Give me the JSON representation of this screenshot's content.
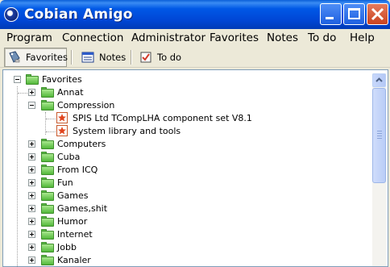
{
  "window": {
    "title": "Cobian Amigo",
    "controls": [
      "minimize",
      "maximize",
      "close"
    ]
  },
  "menu": {
    "items": [
      "Program",
      "Connection",
      "Administrator",
      "Favorites",
      "Notes",
      "To do",
      "Help"
    ]
  },
  "toolbar": {
    "favorites_label": "Favorites",
    "notes_label": "Notes",
    "todo_label": "To do",
    "active": "Favorites"
  },
  "tree": {
    "root": {
      "label": "Favorites",
      "expanded": true
    },
    "items": [
      {
        "label": "Annat",
        "type": "folder",
        "level": 1,
        "expanded": false
      },
      {
        "label": "Compression",
        "type": "folder",
        "level": 1,
        "expanded": true
      },
      {
        "label": "SPIS Ltd TCompLHA component set V8.1",
        "type": "favorite",
        "level": 2
      },
      {
        "label": "System library and tools",
        "type": "favorite",
        "level": 2
      },
      {
        "label": "Computers",
        "type": "folder",
        "level": 1,
        "expanded": false
      },
      {
        "label": "Cuba",
        "type": "folder",
        "level": 1,
        "expanded": false
      },
      {
        "label": "From ICQ",
        "type": "folder",
        "level": 1,
        "expanded": false
      },
      {
        "label": "Fun",
        "type": "folder",
        "level": 1,
        "expanded": false
      },
      {
        "label": "Games",
        "type": "folder",
        "level": 1,
        "expanded": false
      },
      {
        "label": "Games,shit",
        "type": "folder",
        "level": 1,
        "expanded": false
      },
      {
        "label": "Humor",
        "type": "folder",
        "level": 1,
        "expanded": false
      },
      {
        "label": "Internet",
        "type": "folder",
        "level": 1,
        "expanded": false
      },
      {
        "label": "Jobb",
        "type": "folder",
        "level": 1,
        "expanded": false
      },
      {
        "label": "Kanaler",
        "type": "folder",
        "level": 1,
        "expanded": false
      }
    ]
  },
  "colors": {
    "titlebar": "#0058e6",
    "folder": "#52b83a",
    "favorite_icon": "#e0441d",
    "window_bg": "#ece9d8"
  }
}
